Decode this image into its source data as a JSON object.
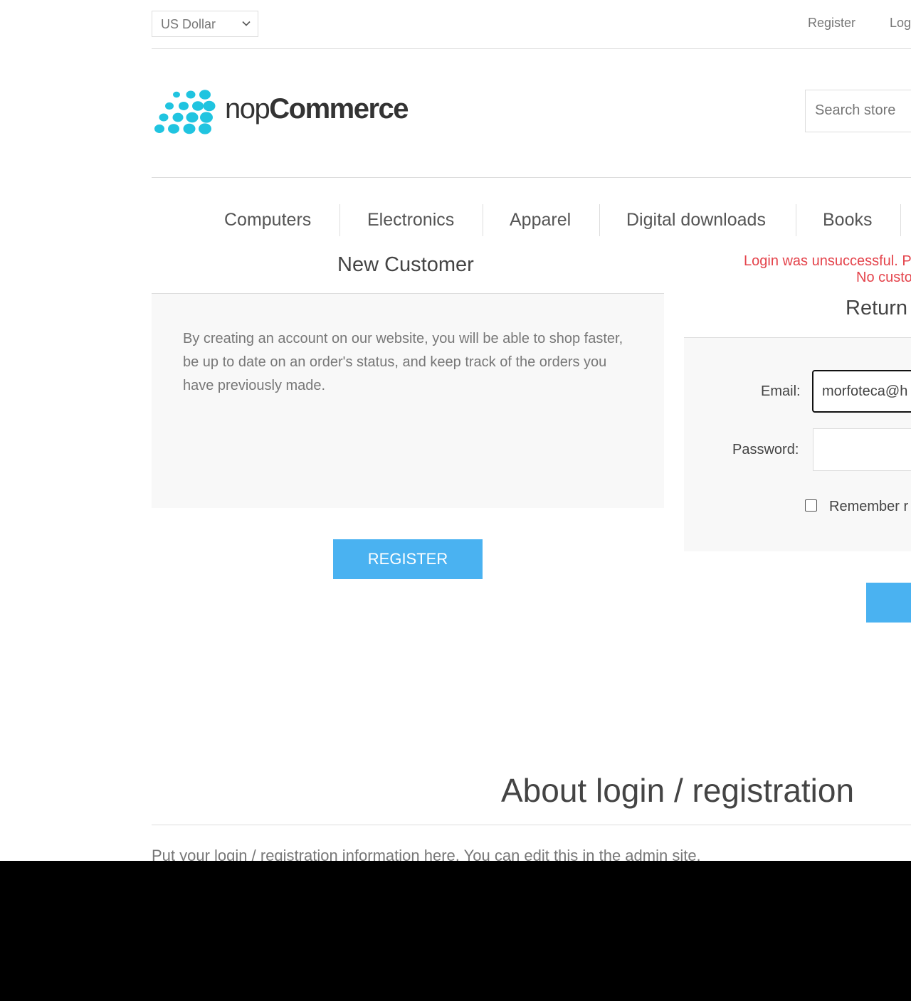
{
  "header": {
    "currency": "US Dollar",
    "register_link": "Register",
    "login_link": "Log"
  },
  "logo": {
    "brand_light": "nop",
    "brand_bold": "Commerce",
    "brand_color": "#20c4e0"
  },
  "search": {
    "placeholder": "Search store"
  },
  "nav": {
    "items": [
      "Computers",
      "Electronics",
      "Apparel",
      "Digital downloads",
      "Books"
    ]
  },
  "new_customer": {
    "title": "New Customer",
    "description": "By creating an account on our website, you will be able to shop faster, be up to date on an order's status, and keep track of the orders you have previously made.",
    "register_button": "REGISTER"
  },
  "returning_customer": {
    "error_line1": "Login was unsuccessful. Pl",
    "error_line2": "No custo",
    "title": "Return",
    "email_label": "Email:",
    "email_value": "morfoteca@h",
    "password_label": "Password:",
    "password_value": "",
    "remember_label": "Remember r"
  },
  "about": {
    "title": "About login / registration",
    "text": "Put your login / registration information here. You can edit this in the admin site."
  },
  "colors": {
    "accent": "#4ab2f1",
    "error": "#e4434b",
    "panel_bg": "#f8f8f8"
  }
}
